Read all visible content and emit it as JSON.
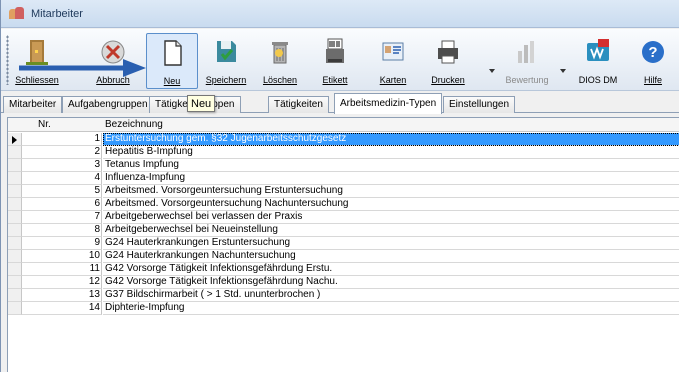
{
  "window": {
    "title": "Mitarbeiter"
  },
  "toolbar": {
    "buttons": [
      {
        "label": "Schliessen",
        "icon": "exit-door-icon"
      },
      {
        "label": "Abbruch",
        "icon": "cancel-icon"
      },
      {
        "label": "Neu",
        "icon": "new-document-icon"
      },
      {
        "label": "Speichern",
        "icon": "save-icon"
      },
      {
        "label": "Löschen",
        "icon": "trash-icon"
      },
      {
        "label": "Etikett",
        "icon": "label-printer-icon"
      },
      {
        "label": "Karten",
        "icon": "cards-icon"
      },
      {
        "label": "Drucken",
        "icon": "printer-icon"
      },
      {
        "label": "Bewertung",
        "icon": "chart-icon"
      },
      {
        "label": "DIOS DM",
        "icon": "dios-dm-icon"
      },
      {
        "label": "Hilfe",
        "icon": "help-icon"
      }
    ]
  },
  "tooltip": {
    "text": "Neu"
  },
  "tabs": [
    {
      "label": "Mitarbeiter"
    },
    {
      "label": "Aufgabengruppen"
    },
    {
      "label": "Tätigkeitsgruppen"
    },
    {
      "label": "Tätigkeiten"
    },
    {
      "label": "Arbeitsmedizin-Typen"
    },
    {
      "label": "Einstellungen"
    }
  ],
  "active_tab": "Arbeitsmedizin-Typen",
  "grid": {
    "columns": [
      "Nr.",
      "Bezeichnung"
    ],
    "rows": [
      {
        "nr": "1",
        "bezeichnung": "Erstuntersuchung gem. §32 Jugenarbeitsschutzgesetz"
      },
      {
        "nr": "2",
        "bezeichnung": "Hepatitis B-Impfung"
      },
      {
        "nr": "3",
        "bezeichnung": "Tetanus Impfung"
      },
      {
        "nr": "4",
        "bezeichnung": "Influenza-Impfung"
      },
      {
        "nr": "5",
        "bezeichnung": "Arbeitsmed. Vorsorgeuntersuchung Erstuntersuchung"
      },
      {
        "nr": "6",
        "bezeichnung": "Arbeitsmed. Vorsorgeuntersuchung Nachuntersuchung"
      },
      {
        "nr": "7",
        "bezeichnung": "Arbeitgeberwechsel bei verlassen der Praxis"
      },
      {
        "nr": "8",
        "bezeichnung": "Arbeitgeberwechsel bei Neueinstellung"
      },
      {
        "nr": "9",
        "bezeichnung": "G24 Hauterkrankungen Erstuntersuchung"
      },
      {
        "nr": "10",
        "bezeichnung": "G24 Hauterkrankungen Nachuntersuchung"
      },
      {
        "nr": "11",
        "bezeichnung": "G42 Vorsorge Tätigkeit Infektionsgefährdung Erstu."
      },
      {
        "nr": "12",
        "bezeichnung": "G42 Vorsorge Tätigkeit Infektionsgefährdung Nachu."
      },
      {
        "nr": "13",
        "bezeichnung": "G37 Bildschirmarbeit ( > 1 Std. ununterbrochen )"
      },
      {
        "nr": "14",
        "bezeichnung": "Diphterie-Impfung"
      }
    ]
  },
  "colors": {
    "selection": "#3399ff",
    "accent": "#2a5fb0"
  }
}
